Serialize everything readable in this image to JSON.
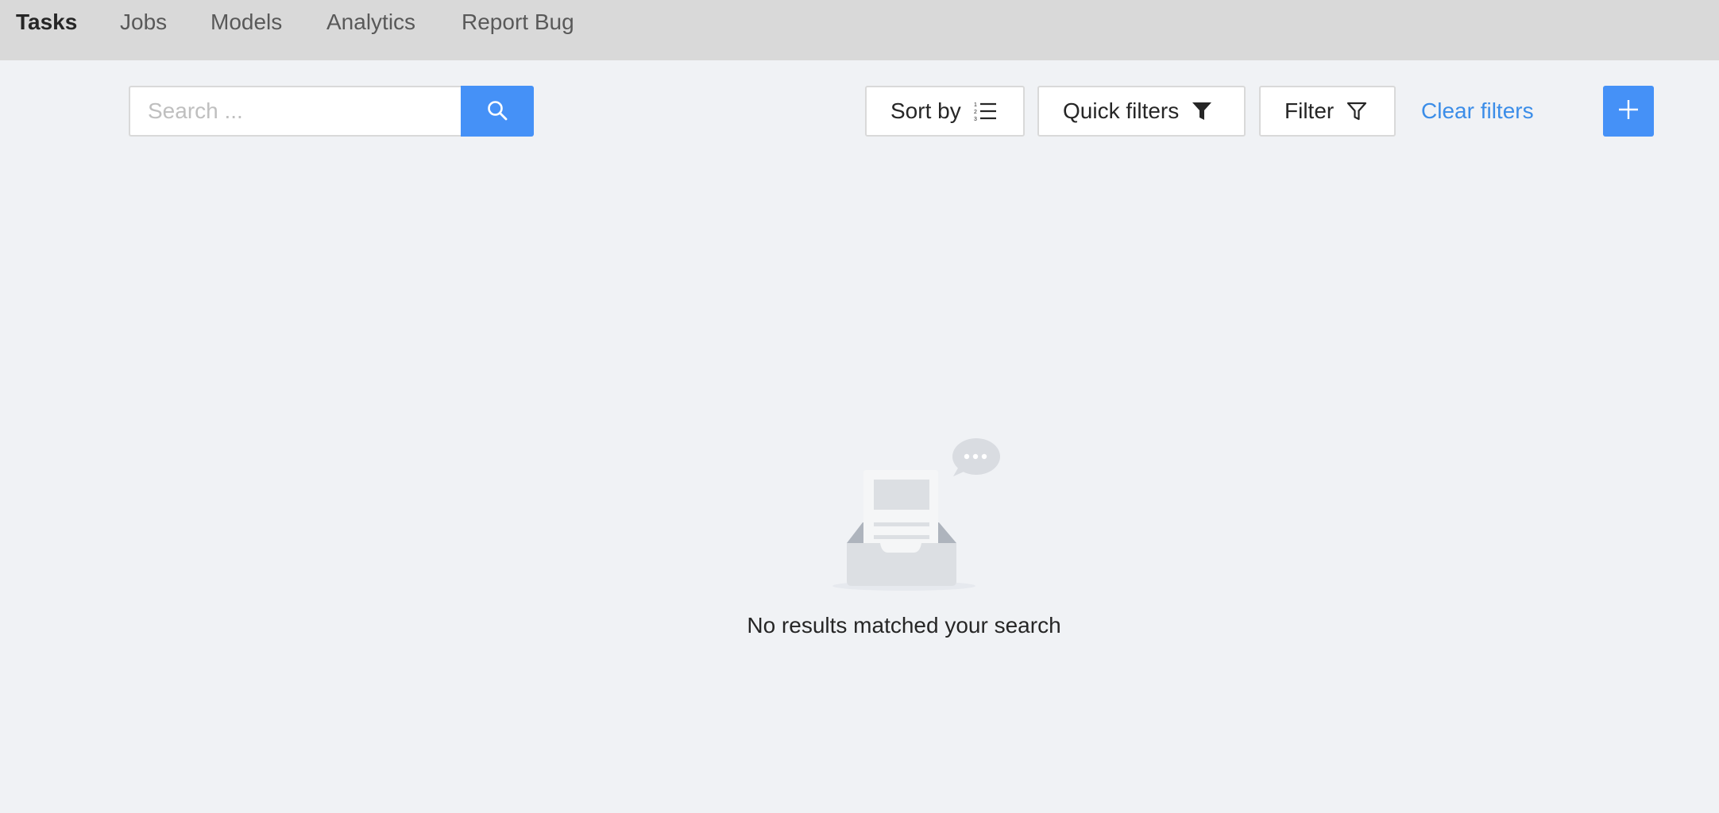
{
  "nav": {
    "items": [
      {
        "label": "Tasks",
        "active": true
      },
      {
        "label": "Jobs",
        "active": false
      },
      {
        "label": "Models",
        "active": false
      },
      {
        "label": "Analytics",
        "active": false
      },
      {
        "label": "Report Bug",
        "active": false
      }
    ]
  },
  "toolbar": {
    "search": {
      "placeholder": "Search ...",
      "value": "",
      "icon": "search-icon"
    },
    "sort_label": "Sort by",
    "quick_filters_label": "Quick filters",
    "filter_label": "Filter",
    "clear_filters_label": "Clear filters",
    "add_icon": "plus-icon"
  },
  "empty_state": {
    "message": "No results matched your search",
    "icon": "empty-inbox-icon"
  },
  "colors": {
    "accent": "#4591f7",
    "link": "#3b8de8",
    "nav_background": "#d9d9d9",
    "page_background": "#f0f2f5"
  }
}
